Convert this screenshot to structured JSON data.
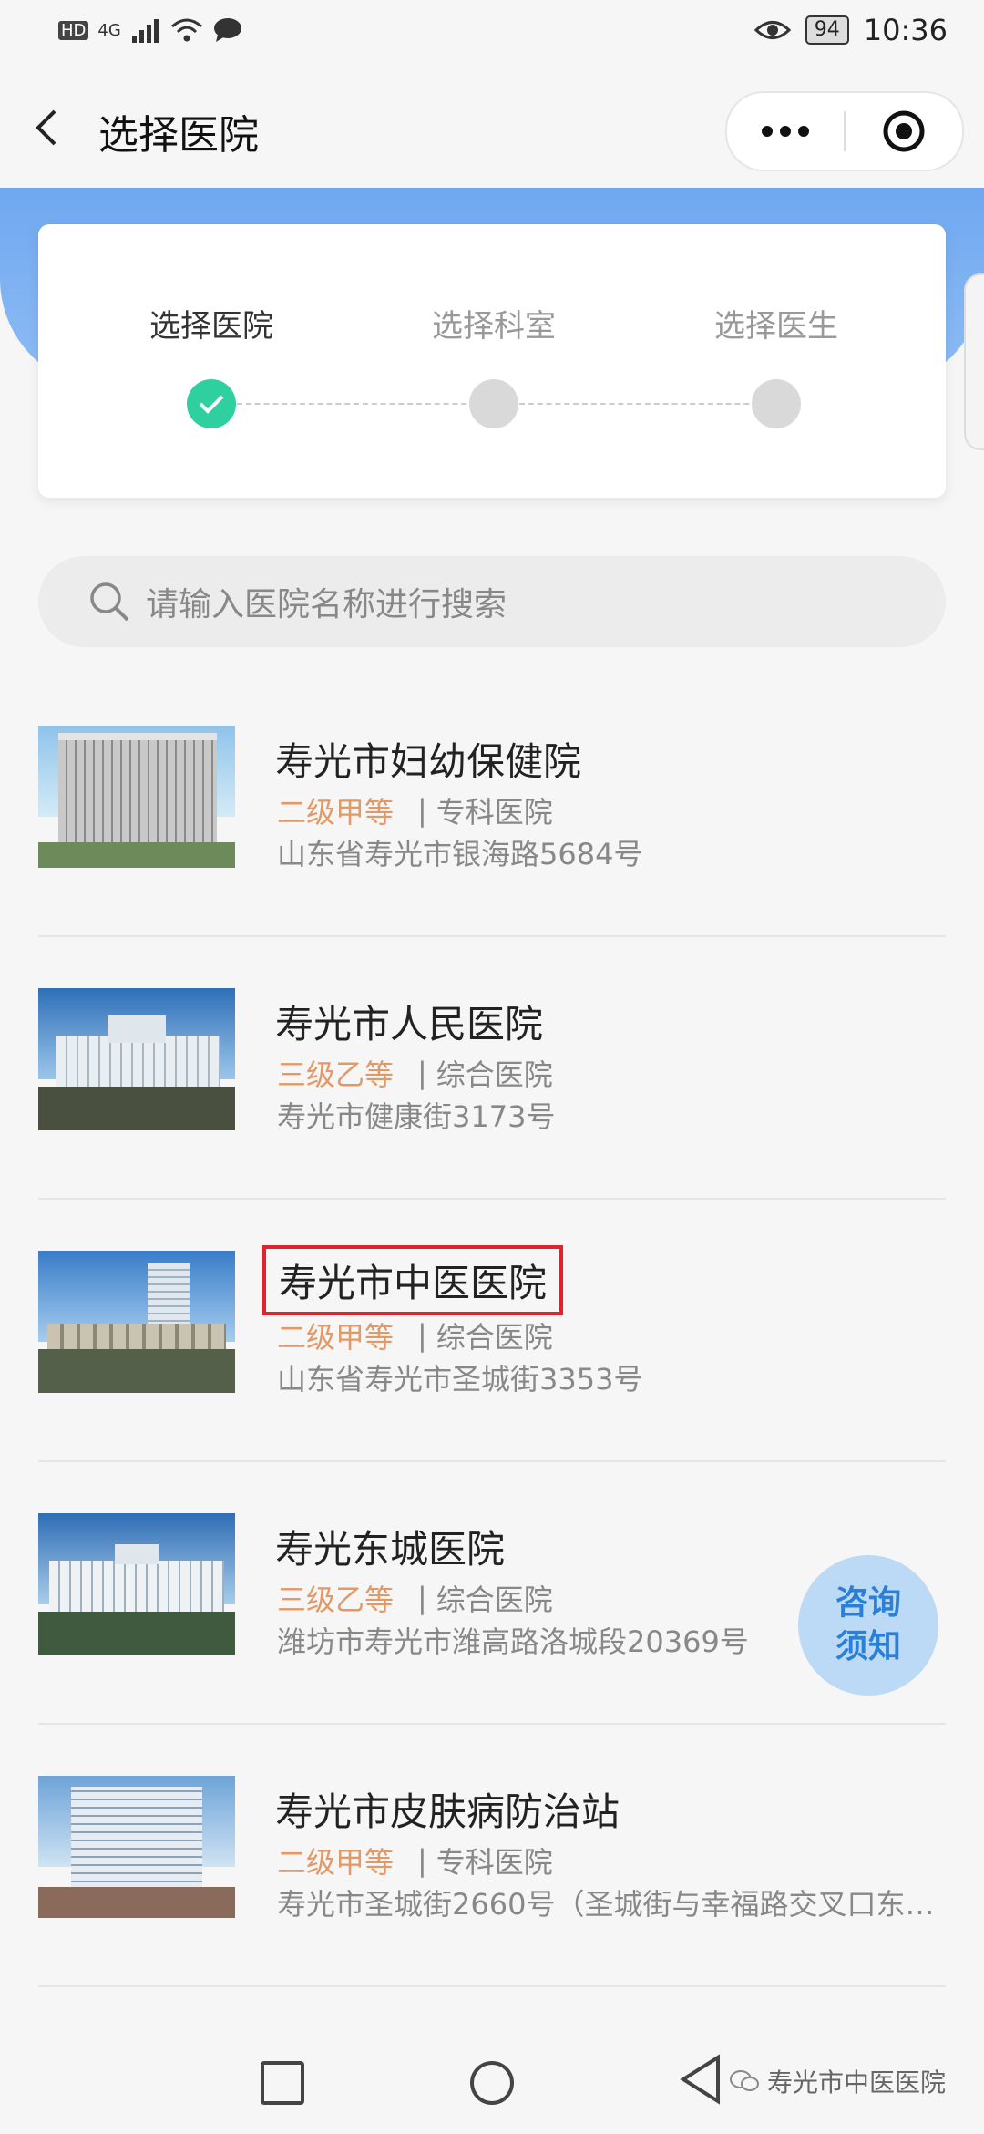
{
  "status_bar": {
    "left_indicators": [
      "HD",
      "4G"
    ],
    "battery": "94",
    "time": "10:36"
  },
  "header": {
    "title": "选择医院",
    "more_icon": "more-dots-icon",
    "target_icon": "target-icon"
  },
  "steps": [
    {
      "label": "选择医院",
      "state": "done"
    },
    {
      "label": "选择科室",
      "state": "pending"
    },
    {
      "label": "选择医生",
      "state": "pending"
    }
  ],
  "search": {
    "placeholder": "请输入医院名称进行搜索"
  },
  "hospitals": [
    {
      "name": "寿光市妇幼保健院",
      "level": "二级甲等",
      "separator": "|",
      "type": "专科医院",
      "address": "山东省寿光市银海路5684号",
      "highlighted": false
    },
    {
      "name": "寿光市人民医院",
      "level": "三级乙等",
      "separator": "|",
      "type": "综合医院",
      "address": "寿光市健康街3173号",
      "highlighted": false
    },
    {
      "name": "寿光市中医医院",
      "level": "二级甲等",
      "separator": "|",
      "type": "综合医院",
      "address": "山东省寿光市圣城街3353号",
      "highlighted": true
    },
    {
      "name": "寿光东城医院",
      "level": "三级乙等",
      "separator": "|",
      "type": "综合医院",
      "address": "潍坊市寿光市潍高路洛城段20369号",
      "highlighted": false
    },
    {
      "name": "寿光市皮肤病防治站",
      "level": "二级甲等",
      "separator": "|",
      "type": "专科医院",
      "address": "寿光市圣城街2660号（圣城街与幸福路交叉口东…",
      "highlighted": false
    }
  ],
  "consult_button": {
    "line1": "咨询",
    "line2": "须知"
  },
  "watermark": "寿光市中医医院",
  "colors": {
    "accent": "#2fd0a0",
    "level": "#e29966",
    "highlight": "#e0242b",
    "blue": "#6fa8f0"
  }
}
